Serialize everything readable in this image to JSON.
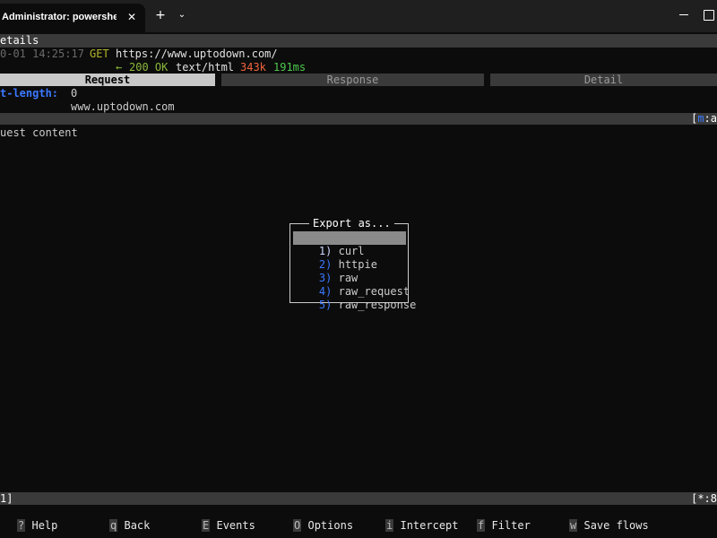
{
  "window": {
    "tab_title": "Administrator: powershell.exe",
    "close_glyph": "✕",
    "new_tab_glyph": "+",
    "dropdown_glyph": "⌄"
  },
  "details_bar": {
    "label": "etails"
  },
  "flow": {
    "timestamp": "0-01 14:25:17",
    "method": "GET",
    "url": "https://www.uptodown.com/",
    "arrow": "←",
    "status": "200 OK",
    "content_type": "text/html",
    "size": "343k",
    "time": "191ms"
  },
  "subtabs": {
    "request": "Request",
    "response": "Response",
    "detail": "Detail"
  },
  "headers": [
    {
      "name": "t-length:",
      "value": "0"
    },
    {
      "name": "",
      "value": "www.uptodown.com"
    }
  ],
  "mid_bar": {
    "right_bracket": "[",
    "right_key": "m",
    "right_rest": ":a"
  },
  "content": {
    "label": "uest content"
  },
  "export_dialog": {
    "title": "Export as...",
    "items": [
      {
        "num": "1)",
        "label": "curl",
        "selected": true
      },
      {
        "num": "2)",
        "label": "httpie",
        "selected": false
      },
      {
        "num": "3)",
        "label": "raw",
        "selected": false
      },
      {
        "num": "4)",
        "label": "raw_request",
        "selected": false
      },
      {
        "num": "5)",
        "label": "raw_response",
        "selected": false
      }
    ]
  },
  "bottom_bar": {
    "left": "1]",
    "right": "[*:8"
  },
  "keybar": [
    {
      "key": "?",
      "label": "Help"
    },
    {
      "key": "q",
      "label": "Back"
    },
    {
      "key": "E",
      "label": "Events"
    },
    {
      "key": "O",
      "label": "Options"
    },
    {
      "key": "i",
      "label": "Intercept"
    },
    {
      "key": "f",
      "label": "Filter"
    },
    {
      "key": "w",
      "label": "Save flows"
    }
  ],
  "colors": {
    "background": "#0c0c0c",
    "method": "#b5b52a",
    "url": "#e0e0e0",
    "status_ok": "#8ab83a",
    "size_warn": "#f0643c",
    "time_ok": "#4ec94e",
    "header_name": "#3b78ff",
    "menu_number": "#3b78ff"
  }
}
